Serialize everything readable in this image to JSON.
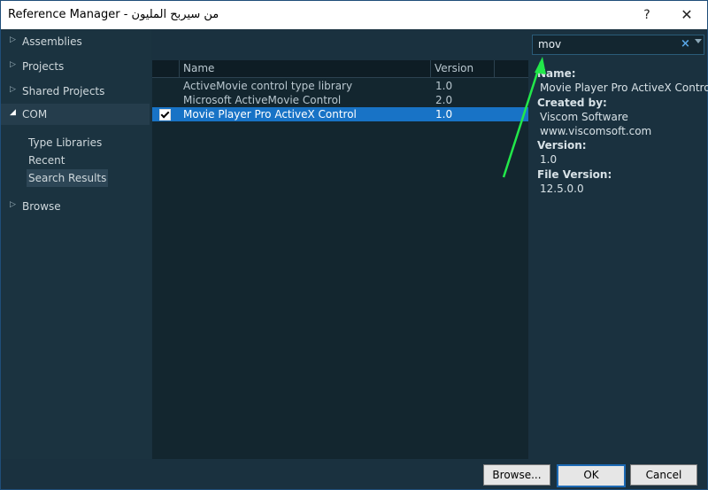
{
  "window": {
    "title": "Reference Manager - من سيربح المليون",
    "help_label": "?",
    "close_label": "✕"
  },
  "nav": {
    "assemblies": "Assemblies",
    "projects": "Projects",
    "shared_projects": "Shared Projects",
    "com": "COM",
    "type_libraries": "Type Libraries",
    "recent": "Recent",
    "search_results": "Search Results",
    "browse": "Browse"
  },
  "grid": {
    "col_name": "Name",
    "col_version": "Version",
    "rows": [
      {
        "name": "ActiveMovie control type library",
        "version": "1.0",
        "checked": false
      },
      {
        "name": "Microsoft ActiveMovie Control",
        "version": "2.0",
        "checked": false
      },
      {
        "name": "Movie Player Pro ActiveX Control",
        "version": "1.0",
        "checked": true
      }
    ]
  },
  "search": {
    "value": "mov",
    "clear_label": "×"
  },
  "details": {
    "name_label": "Name:",
    "name_value": "Movie Player Pro ActiveX Control",
    "created_label": "Created by:",
    "created_value1": "Viscom Software",
    "created_value2": "www.viscomsoft.com",
    "version_label": "Version:",
    "version_value": "1.0",
    "file_version_label": "File Version:",
    "file_version_value": "12.5.0.0"
  },
  "footer": {
    "browse_label": "Browse...",
    "ok_label": "OK",
    "cancel_label": "Cancel"
  },
  "colors": {
    "accent": "#1873c6",
    "panel": "#1a313f",
    "annotation_arrow": "#22e84a"
  }
}
